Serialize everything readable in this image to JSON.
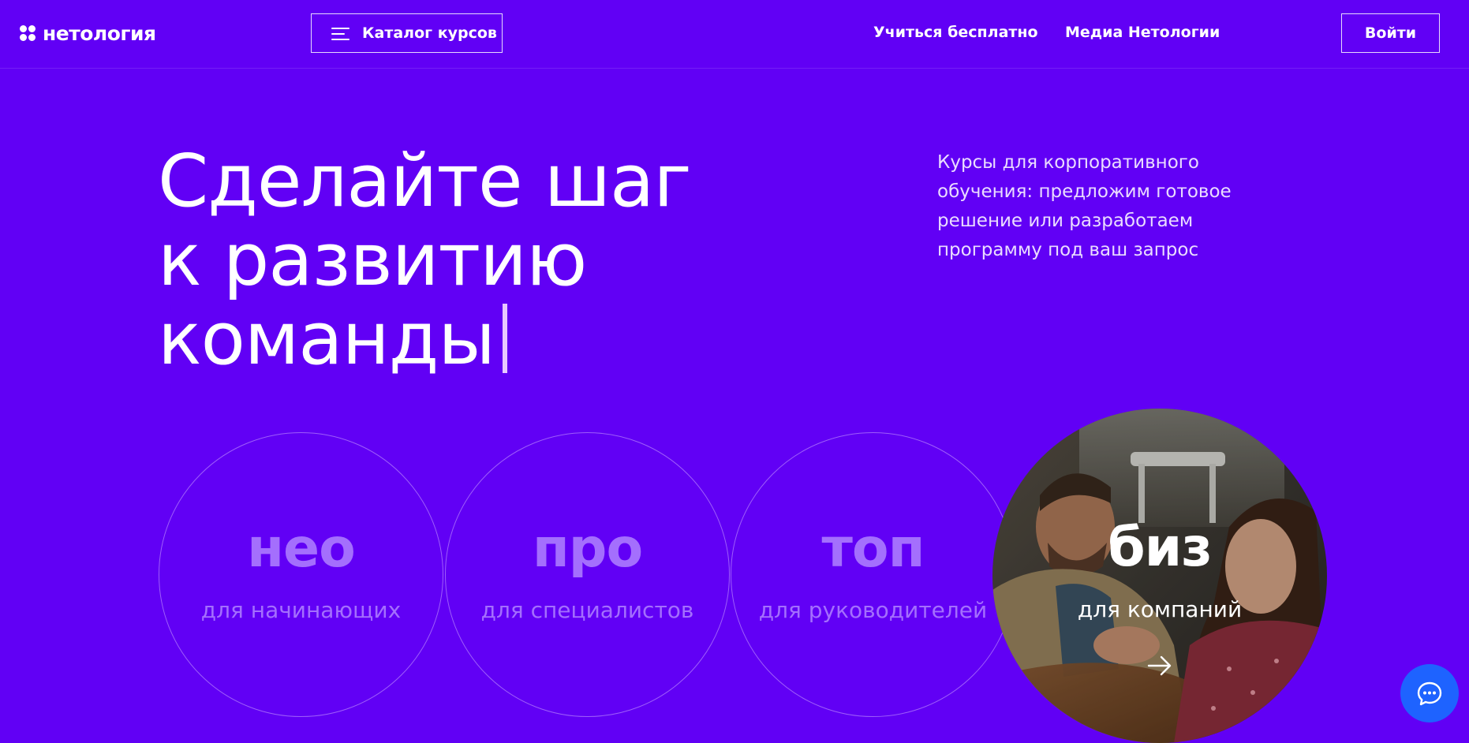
{
  "header": {
    "logo_text": "нетология",
    "catalog_label": "Каталог курсов",
    "nav": [
      {
        "label": "Учиться бесплатно"
      },
      {
        "label": "Медиа Нетологии"
      }
    ],
    "login_label": "Войти"
  },
  "hero": {
    "title_lines": [
      "Сделайте шаг",
      "к развитию",
      "команды"
    ],
    "description": "Курсы для корпоративного обучения: предложим готовое решение или разработаем программу под ваш запрос"
  },
  "segments": [
    {
      "name": "нео",
      "audience": "для начинающих"
    },
    {
      "name": "про",
      "audience": "для специалистов"
    },
    {
      "name": "топ",
      "audience": "для руководителей"
    },
    {
      "name": "биз",
      "audience": "для компаний"
    }
  ],
  "chat": {
    "icon": "chat-bubble-icon"
  },
  "colors": {
    "background": "#6100f5",
    "muted_purple": "#a46ffd",
    "chat_blue": "#1e63ff"
  }
}
